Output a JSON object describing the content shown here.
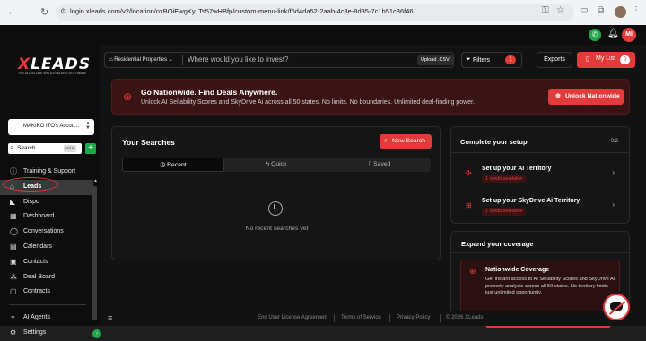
{
  "browser": {
    "url": "login.xleads.com/v2/location/nxBOiEwgKyLTs57wHBfp/custom-menu-link/f6d4da52-2aab-4c3e-8d35-7c1b51c86f46"
  },
  "topbar": {
    "avatar_initials": "MI"
  },
  "sidebar": {
    "logo": {
      "text_x": "X",
      "text_rest": "LEADS",
      "tagline": "THE ALL-IN-ONE WHOLESALER'S SOFTWARE"
    },
    "account_name": "MAKIKO ITO's Accou...",
    "search": {
      "label": "Search",
      "shortcut": "ctrl K"
    },
    "items": [
      {
        "label": "Training & Support",
        "icon": "info-icon"
      },
      {
        "label": "Leads",
        "icon": "home-icon",
        "active": true
      },
      {
        "label": "Dispo",
        "icon": "tag-icon"
      },
      {
        "label": "Dashboard",
        "icon": "grid-icon"
      },
      {
        "label": "Conversations",
        "icon": "chat-icon"
      },
      {
        "label": "Calendars",
        "icon": "calendar-icon"
      },
      {
        "label": "Contacts",
        "icon": "contacts-icon"
      },
      {
        "label": "Deal Board",
        "icon": "board-icon"
      },
      {
        "label": "Contracts",
        "icon": "contract-icon"
      }
    ],
    "bottom_items": [
      {
        "label": "AI Agents",
        "icon": "sparkle-icon"
      },
      {
        "label": "Settings",
        "icon": "gear-icon"
      }
    ],
    "overlap_text": "Notification"
  },
  "header": {
    "property_type": "Residential Properties",
    "search_placeholder": "Where would you like to invest?",
    "upload_label": "Upload .CSV",
    "filters_label": "Filters",
    "filters_count": "1",
    "exports_label": "Exports",
    "mylist_label": "My List",
    "mylist_count": "0"
  },
  "banner": {
    "title": "Go Nationwide. Find Deals Anywhere.",
    "desc": "Unlock AI Sellability Scores and SkyDrive Ai across all 50 states. No limits. No boundaries. Unlimited deal-finding power.",
    "button": "Unlock Nationwide"
  },
  "searches": {
    "title": "Your Searches",
    "new_button": "New Search",
    "tabs": [
      {
        "label": "Recent",
        "icon": "clock"
      },
      {
        "label": "Quick",
        "icon": "bolt"
      },
      {
        "label": "Saved",
        "icon": "bookmark"
      }
    ],
    "empty_text": "No recent searches yet"
  },
  "setup": {
    "title": "Complete your setup",
    "count": "0/2",
    "items": [
      {
        "name": "Set up your AI Territory",
        "badge": "1 credit available"
      },
      {
        "name": "Set up your SkyDrive Ai Territory",
        "badge": "1 credit available"
      }
    ]
  },
  "expand": {
    "title": "Expand your coverage",
    "box_title": "Nationwide Coverage",
    "box_desc": "Get instant access to AI Sellability Scores and SkyDrive Ai property analysis across all 50 states. No territory limits - just unlimited opportunity."
  },
  "footer": {
    "links": [
      "End User License Agreement",
      "Terms of Service",
      "Privacy Policy"
    ],
    "copyright": "© 2026 XLeads"
  }
}
